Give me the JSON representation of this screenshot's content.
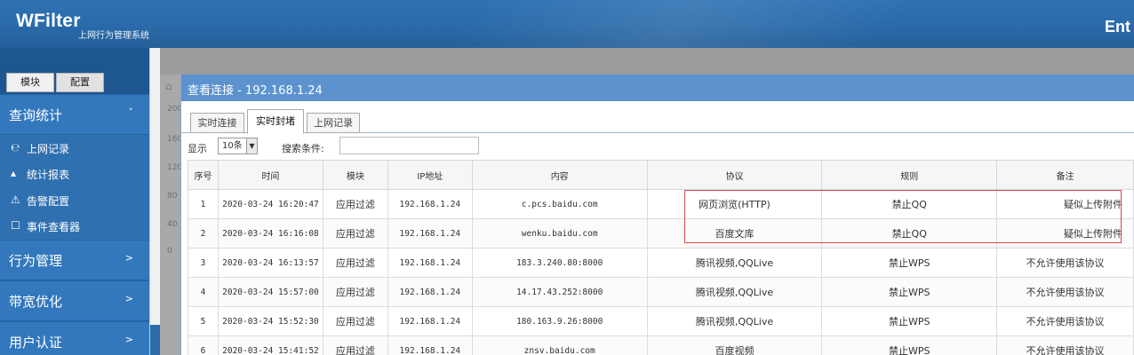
{
  "header": {
    "brand": "WFilter",
    "subtitle": "上网行为管理系统",
    "right_text": "Ent"
  },
  "sidebar": {
    "tabs": [
      "模块",
      "配置"
    ],
    "sections": [
      {
        "label": "查询统计",
        "arrow": "˅"
      },
      {
        "label": "行为管理",
        "arrow": ">"
      },
      {
        "label": "带宽优化",
        "arrow": ">"
      },
      {
        "label": "用户认证",
        "arrow": ">"
      }
    ],
    "items": [
      {
        "label": "上网记录",
        "icon": "e-browser-icon",
        "glyph": "℮"
      },
      {
        "label": "统计报表",
        "icon": "chart-icon",
        "glyph": "▴"
      },
      {
        "label": "告警配置",
        "icon": "alert-icon",
        "glyph": "⚠"
      },
      {
        "label": "事件查看器",
        "icon": "message-icon",
        "glyph": "☐"
      }
    ]
  },
  "backdrop": {
    "yaxis": [
      "200",
      "160",
      "120",
      "80",
      "40",
      "0"
    ]
  },
  "dialog": {
    "title": "查看连接 - 192.168.1.24",
    "tabs": [
      "实时连接",
      "实时封堵",
      "上网记录"
    ],
    "active_tab": "实时封堵",
    "filter": {
      "show_label": "显示",
      "page_size": "10条",
      "search_label": "搜索条件:",
      "search_value": ""
    },
    "table": {
      "columns": [
        "序号",
        "时间",
        "模块",
        "IP地址",
        "内容",
        "协议",
        "规则",
        "备注"
      ],
      "rows": [
        [
          "1",
          "2020-03-24 16:20:47",
          "应用过滤",
          "192.168.1.24",
          "c.pcs.baidu.com",
          "网页浏览(HTTP)",
          "禁止QQ",
          "疑似上传附件"
        ],
        [
          "2",
          "2020-03-24 16:16:08",
          "应用过滤",
          "192.168.1.24",
          "wenku.baidu.com",
          "百度文库",
          "禁止QQ",
          "疑似上传附件"
        ],
        [
          "3",
          "2020-03-24 16:13:57",
          "应用过滤",
          "192.168.1.24",
          "183.3.240.80:8000",
          "腾讯视频,QQLive",
          "禁止WPS",
          "不允许使用该协议"
        ],
        [
          "4",
          "2020-03-24 15:57:00",
          "应用过滤",
          "192.168.1.24",
          "14.17.43.252:8000",
          "腾讯视频,QQLive",
          "禁止WPS",
          "不允许使用该协议"
        ],
        [
          "5",
          "2020-03-24 15:52:30",
          "应用过滤",
          "192.168.1.24",
          "180.163.9.26:8000",
          "腾讯视频,QQLive",
          "禁止WPS",
          "不允许使用该协议"
        ],
        [
          "6",
          "2020-03-24 15:41:52",
          "应用过滤",
          "192.168.1.24",
          "znsv.baidu.com",
          "百度视频",
          "禁止WPS",
          "不允许使用该协议"
        ]
      ]
    }
  },
  "colors": {
    "header": "#2f72b3",
    "sidebar": "#2b6cab",
    "dialog_title": "#5c93cf",
    "highlight": "#d04a4a"
  }
}
